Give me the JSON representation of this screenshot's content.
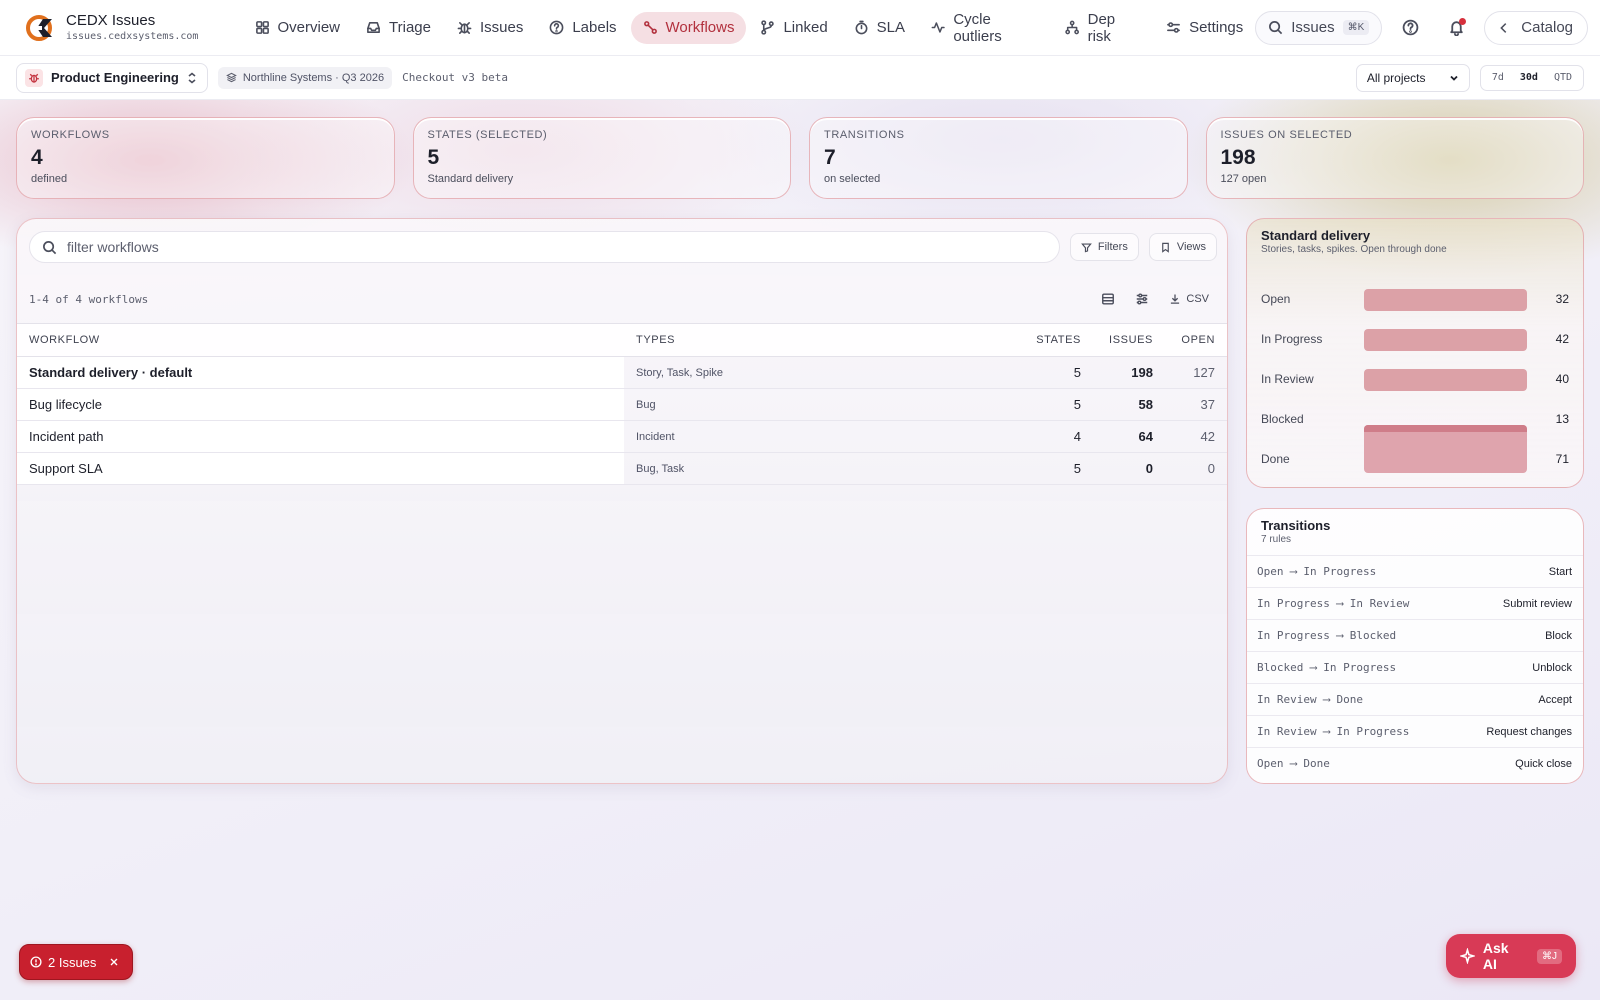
{
  "app": {
    "name": "CEDX Issues",
    "url": "issues.cedxsystems.com"
  },
  "nav": {
    "items": [
      {
        "label": "Overview",
        "icon": "grid-icon"
      },
      {
        "label": "Triage",
        "icon": "inbox-icon"
      },
      {
        "label": "Issues",
        "icon": "bug-icon"
      },
      {
        "label": "Labels",
        "icon": "help-circle-icon"
      },
      {
        "label": "Workflows",
        "icon": "workflow-icon",
        "active": true
      },
      {
        "label": "Linked",
        "icon": "git-branch-icon"
      },
      {
        "label": "SLA",
        "icon": "timer-icon"
      },
      {
        "label": "Cycle outliers",
        "icon": "activity-icon"
      },
      {
        "label": "Dep risk",
        "icon": "network-icon"
      },
      {
        "label": "Settings",
        "icon": "sliders-icon"
      }
    ],
    "command": {
      "label": "Issues",
      "shortcut": "⌘K"
    },
    "catalog": "Catalog"
  },
  "subbar": {
    "team": "Product Engineering",
    "org": "Northline Systems · Q3 2026",
    "release": "Checkout v3 beta",
    "project_filter": "All projects",
    "ranges": [
      "7d",
      "30d",
      "QTD"
    ],
    "active_range": "30d"
  },
  "stats": [
    {
      "label": "WORKFLOWS",
      "value": "4",
      "sub": "defined"
    },
    {
      "label": "STATES (SELECTED)",
      "value": "5",
      "sub": "Standard delivery"
    },
    {
      "label": "TRANSITIONS",
      "value": "7",
      "sub": "on selected"
    },
    {
      "label": "ISSUES ON SELECTED",
      "value": "198",
      "sub": "127 open"
    }
  ],
  "table": {
    "search_placeholder": "filter workflows",
    "filters_label": "Filters",
    "views_label": "Views",
    "count_text": "1-4 of 4 workflows",
    "csv_label": "CSV",
    "columns": [
      "WORKFLOW",
      "TYPES",
      "STATES",
      "ISSUES",
      "OPEN"
    ],
    "rows": [
      {
        "name": "Standard delivery · default",
        "types": "Story, Task, Spike",
        "states": "5",
        "issues": "198",
        "open": "127"
      },
      {
        "name": "Bug lifecycle",
        "types": "Bug",
        "states": "5",
        "issues": "58",
        "open": "37"
      },
      {
        "name": "Incident path",
        "types": "Incident",
        "states": "4",
        "issues": "64",
        "open": "42"
      },
      {
        "name": "Support SLA",
        "types": "Bug, Task",
        "states": "5",
        "issues": "0",
        "open": "0"
      }
    ]
  },
  "distribution": {
    "title": "Standard delivery",
    "subtitle": "Stories, tasks, spikes. Open through done",
    "states": [
      {
        "label": "Open",
        "count": "32"
      },
      {
        "label": "In Progress",
        "count": "42"
      },
      {
        "label": "In Review",
        "count": "40"
      },
      {
        "label": "Blocked",
        "count": "13"
      },
      {
        "label": "Done",
        "count": "71"
      }
    ]
  },
  "transitions": {
    "title": "Transitions",
    "subtitle": "7 rules",
    "rules": [
      {
        "from": "Open",
        "to": "In Progress",
        "action": "Start"
      },
      {
        "from": "In Progress",
        "to": "In Review",
        "action": "Submit review"
      },
      {
        "from": "In Progress",
        "to": "Blocked",
        "action": "Block"
      },
      {
        "from": "Blocked",
        "to": "In Progress",
        "action": "Unblock"
      },
      {
        "from": "In Review",
        "to": "Done",
        "action": "Accept"
      },
      {
        "from": "In Review",
        "to": "In Progress",
        "action": "Request changes"
      },
      {
        "from": "Open",
        "to": "Done",
        "action": "Quick close"
      }
    ],
    "arrow": "⟶"
  },
  "floating": {
    "issues_pill": "2 Issues",
    "ask_ai": "Ask AI",
    "ask_ai_shortcut": "⌘J"
  },
  "colors": {
    "accent": "#b2303d",
    "danger": "#c8202e",
    "ai": "#d83a56",
    "bar": "#dca1a7"
  }
}
